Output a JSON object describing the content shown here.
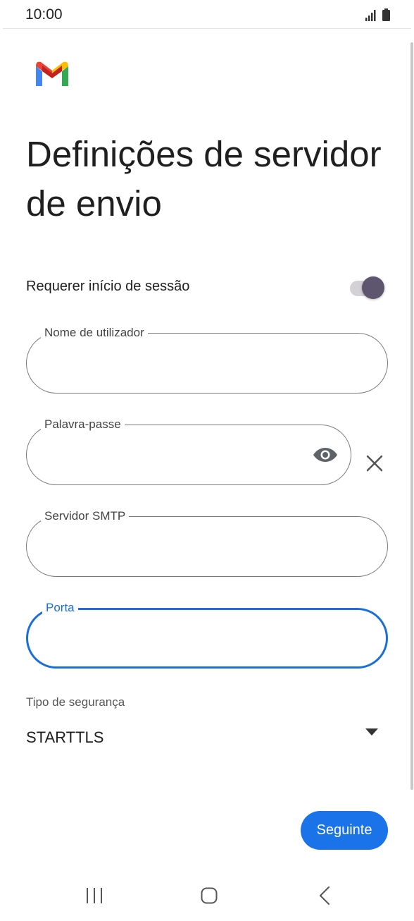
{
  "status_bar": {
    "time": "10:00"
  },
  "app": {
    "logo_icon": "gmail-logo-icon",
    "title": "Definições de servidor de envio"
  },
  "login_toggle": {
    "label": "Requerer início de sessão",
    "enabled": true
  },
  "fields": {
    "username": {
      "label": "Nome de utilizador",
      "value": ""
    },
    "password": {
      "label": "Palavra-passe",
      "value": ""
    },
    "smtp_server": {
      "label": "Servidor SMTP",
      "value": ""
    },
    "port": {
      "label": "Porta",
      "value": ""
    }
  },
  "security": {
    "label": "Tipo de segurança",
    "selected": "STARTTLS"
  },
  "actions": {
    "next_label": "Seguinte"
  },
  "colors": {
    "accent": "#1a73e8",
    "focus_border": "#1a6fd8",
    "toggle_thumb": "#5d566e"
  }
}
